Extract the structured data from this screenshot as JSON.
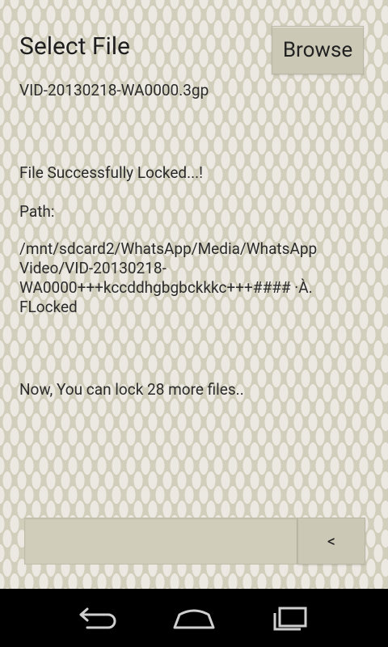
{
  "header": {
    "title": "Select File",
    "browse_label": "Browse"
  },
  "file": {
    "name": "VID-20130218-WA0000.3gp"
  },
  "status": {
    "success_message": "File Successfully Locked...!",
    "path_label": "Path:",
    "path_lines": [
      "/mnt/sdcard2/WhatsApp/Media/WhatsApp",
      "Video/VID-20130218-",
      "WA0000+++kccddhgbgbckkkc+++#### ·À.",
      "FLocked"
    ],
    "remaining_message": "Now, You can lock 28 more files.."
  },
  "bottom": {
    "input_hint": "",
    "back_label": "<"
  },
  "navbar": {
    "icons": [
      "back-icon",
      "home-icon",
      "recent-apps-icon"
    ]
  },
  "colors": {
    "background": "#d2cebc",
    "button": "#cbc8b6",
    "navbar": "#000000"
  }
}
